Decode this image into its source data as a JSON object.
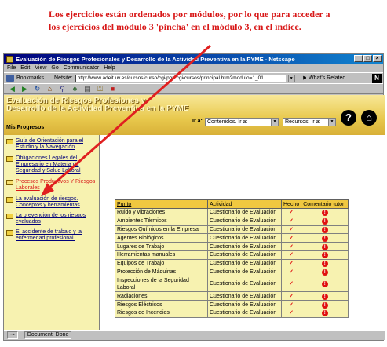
{
  "instruction": {
    "line1": "Los ejercicios están ordenados por módulos, por lo que para acceder a",
    "line2": "los ejercicios del módulo 3 'pincha' en el módulo 3, en el índice."
  },
  "browser": {
    "title": "Evaluación de Riesgos Profesionales y Desarrollo de la Actividad Preventiva en la PYME - Netscape",
    "menu": [
      "File",
      "Edit",
      "View",
      "Go",
      "Communicator",
      "Help"
    ],
    "bookmarks_label": "Bookmarks",
    "netsite_label": "Netsite:",
    "url": "http://www.adeit.uv.es/cursos/curso/cgi/php.cgi/cursos/principal.htm?modulo=1_01",
    "related_label": "What's Related",
    "status": "Document: Done"
  },
  "app": {
    "title_line1": "Evaluación de Riesgos Profesiones y",
    "title_line2": "Desarrollo de la Actividad Preventiva en la PYME",
    "section": "Mis Progresos",
    "ira_label": "Ir a:",
    "contenidos_select": "Contenidos. Ir a:",
    "recursos_select": "Recursos. Ir a:",
    "help_symbol": "?",
    "home_symbol": "⌂"
  },
  "sidebar": {
    "items": [
      {
        "label": "Guía de Orientación para el Estudio y la Navegación"
      },
      {
        "label": "Obligaciones Legales del Empresario en Materia de Seguridad y Salud Laboral"
      },
      {
        "label": "Procesos Productivos Y Riesgos Laborales"
      },
      {
        "label": "La evaluación de riesgos. Conceptos y herramientas"
      },
      {
        "label": "La prevención de los riesgos evaluados"
      },
      {
        "label": "El accidente de trabajo y la enfermedad profesional."
      }
    ]
  },
  "table": {
    "headers": [
      "Punto",
      "Actividad",
      "Hecho",
      "Comentario tutor"
    ],
    "rows": [
      {
        "punto": "Ruido y vibraciones",
        "actividad": "Cuestionario de Evaluación"
      },
      {
        "punto": "Ambientes Térmicos",
        "actividad": "Cuestionario de Evaluación"
      },
      {
        "punto": "Riesgos Químicos en la Empresa",
        "actividad": "Cuestionario de Evaluación"
      },
      {
        "punto": "Agentes Biológicos",
        "actividad": "Cuestionario de Evaluación"
      },
      {
        "punto": "Lugares de Trabajo",
        "actividad": "Cuestionario de Evaluación"
      },
      {
        "punto": "Herramientas manuales",
        "actividad": "Cuestionario de Evaluación"
      },
      {
        "punto": "Equipos de Trabajo",
        "actividad": "Cuestionario de Evaluación"
      },
      {
        "punto": "Protección de Máquinas",
        "actividad": "Cuestionario de Evaluación"
      },
      {
        "punto": "Inspecciones de la Seguridad Laboral",
        "actividad": "Cuestionario de Evaluación"
      },
      {
        "punto": "Radiaciones",
        "actividad": "Cuestionario de Evaluación"
      },
      {
        "punto": "Riesgos Eléctricos",
        "actividad": "Cuestionario de Evaluación"
      },
      {
        "punto": "Riesgos de Incendios",
        "actividad": "Cuestionario de Evaluación"
      }
    ],
    "done_mark": "✓",
    "comment_mark": "!"
  }
}
